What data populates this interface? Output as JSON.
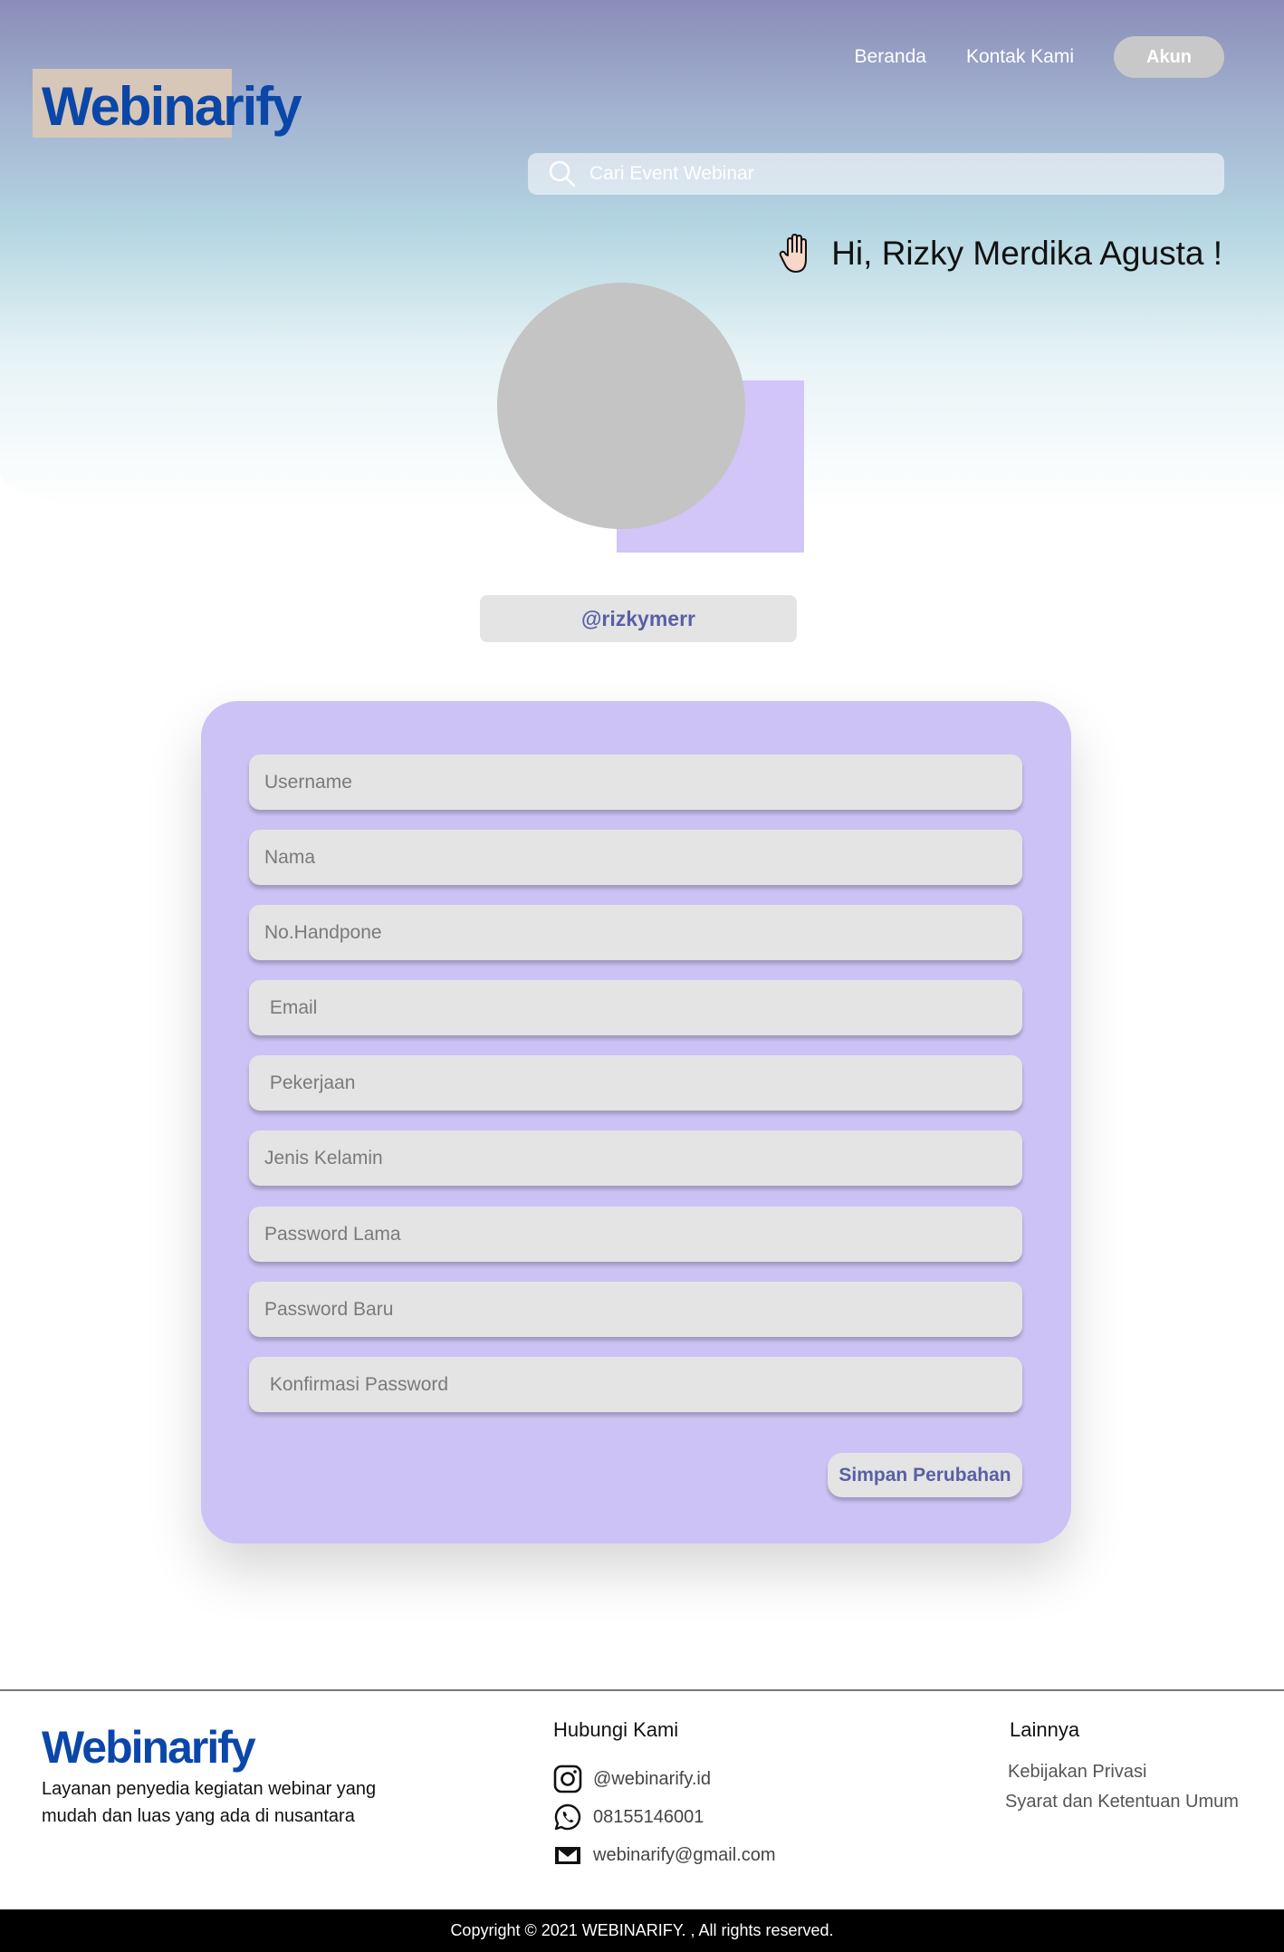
{
  "brand": {
    "name": "Webinarify",
    "color": "#0a47a8"
  },
  "nav": {
    "home": "Beranda",
    "contact": "Kontak Kami",
    "account": "Akun"
  },
  "search": {
    "placeholder": "Cari Event Webinar",
    "icon": "search-icon"
  },
  "greeting": {
    "icon": "waving-hand-icon",
    "text": "Hi, Rizky Merdika Agusta !"
  },
  "profile": {
    "username_display": "@rizkymerr"
  },
  "form": {
    "fields": [
      {
        "placeholder": "Username",
        "value": ""
      },
      {
        "placeholder": "Nama",
        "value": ""
      },
      {
        "placeholder": "No.Handpone",
        "value": ""
      },
      {
        "placeholder": " Email",
        "value": ""
      },
      {
        "placeholder": " Pekerjaan",
        "value": ""
      },
      {
        "placeholder": "Jenis Kelamin",
        "value": ""
      },
      {
        "placeholder": "Password Lama",
        "value": ""
      },
      {
        "placeholder": "Password Baru",
        "value": ""
      },
      {
        "placeholder": " Konfirmasi Password",
        "value": ""
      }
    ],
    "save_label": "Simpan Perubahan"
  },
  "footer": {
    "logo": "Webinarify",
    "description": "Layanan penyedia kegiatan webinar yang mudah dan luas yang ada di nusantara",
    "contact_heading": "Hubungi Kami",
    "contacts": [
      {
        "icon": "instagram-icon",
        "text": "@webinarify.id"
      },
      {
        "icon": "whatsapp-icon",
        "text": "08155146001"
      },
      {
        "icon": "mail-icon",
        "text": "webinarify@gmail.com"
      }
    ],
    "other_heading": "Lainnya",
    "other_links": [
      "Kebijakan Privasi",
      "Syarat dan Ketentuan Umum"
    ],
    "copyright": "Copyright © 2021 WEBINARIFY. , All rights reserved."
  },
  "colors": {
    "card": "#cdc2f5",
    "avatar_accent": "#d2c5f7",
    "accent_text": "#5a5fa6",
    "field_bg": "#e4e4e4"
  }
}
